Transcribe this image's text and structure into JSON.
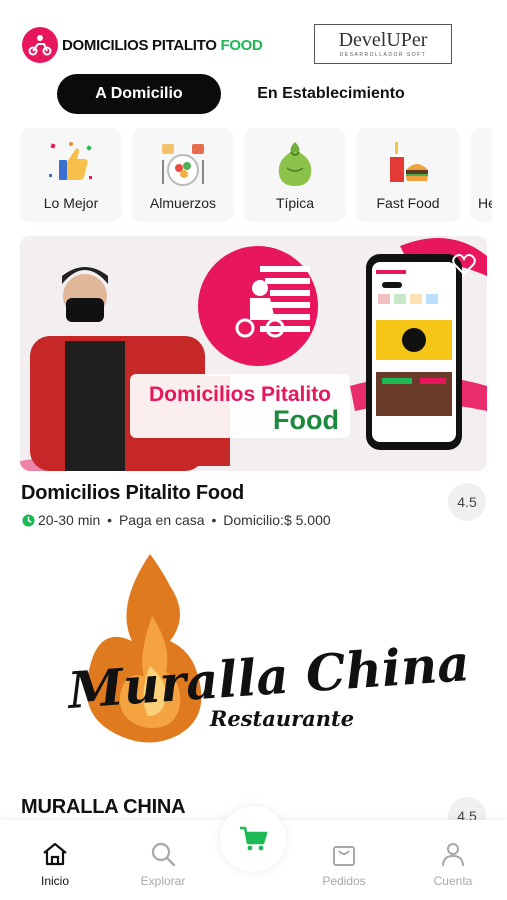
{
  "header": {
    "brand_main": "DOMICILIOS PITALITO",
    "brand_accent": "FOOD",
    "dev_name": "DevelUPer",
    "dev_tagline": "DESARROLLADOR SOFT"
  },
  "mode": {
    "active": "A Domicilio",
    "inactive": "En Establecimiento"
  },
  "categories": [
    {
      "label": "Lo Mejor",
      "icon": "thumbs-up-icon"
    },
    {
      "label": "Almuerzos",
      "icon": "plate-icon"
    },
    {
      "label": "Típica",
      "icon": "bag-icon"
    },
    {
      "label": "Fast Food",
      "icon": "burger-icon"
    },
    {
      "label": "Heladeı",
      "icon": "ice-cream-icon"
    }
  ],
  "restaurants": [
    {
      "name": "Domicilios Pitalito Food",
      "time": "20-30 min",
      "payment": "Paga en casa",
      "delivery": "Domicilio:$ 5.000",
      "rating": "4.5",
      "banner_line1": "Domicilios Pitalito",
      "banner_line2": "Food"
    },
    {
      "name": "MURALLA CHINA",
      "rating": "4.5",
      "logo_line1": "Muralla China",
      "logo_line2": "Restaurante"
    }
  ],
  "nav": [
    {
      "label": "Inicio",
      "icon": "home-icon"
    },
    {
      "label": "Explorar",
      "icon": "search-icon"
    },
    {
      "label": "Pedidos",
      "icon": "shopping-bag-icon"
    },
    {
      "label": "Cuenta",
      "icon": "user-icon"
    }
  ],
  "colors": {
    "brand_pink": "#e8175d",
    "brand_green": "#1db954",
    "active_toggle": "#0b0b0b"
  }
}
